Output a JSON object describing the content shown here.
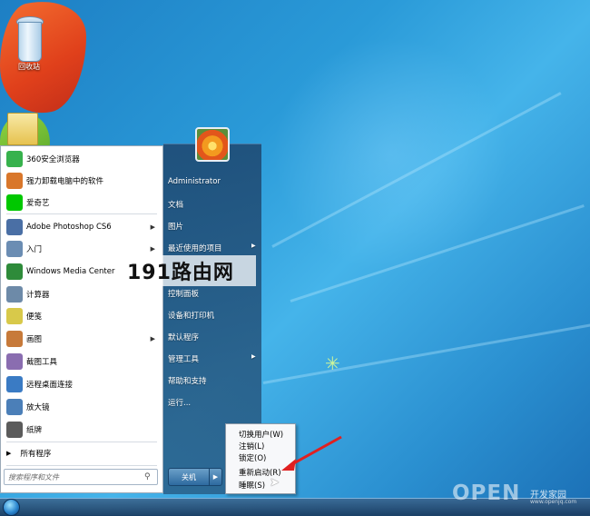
{
  "desktop": {
    "icons": [
      {
        "label": "回收站"
      }
    ]
  },
  "start_menu": {
    "programs": [
      {
        "label": "360安全浏览器",
        "icon": "360-browser-icon",
        "color": "#37b24d",
        "has_submenu": false
      },
      {
        "label": "强力卸载电脑中的软件",
        "icon": "uninstall-icon",
        "color": "#d9772b",
        "has_submenu": false
      },
      {
        "label": "爱奇艺",
        "icon": "iqiyi-icon",
        "color": "#00c800",
        "has_submenu": false
      },
      {
        "label": "Adobe Photoshop CS6",
        "icon": "photoshop-icon",
        "color": "#4a6fa5",
        "has_submenu": true
      },
      {
        "label": "入门",
        "icon": "getting-started-icon",
        "color": "#6b8db3",
        "has_submenu": true
      },
      {
        "label": "Windows Media Center",
        "icon": "media-center-icon",
        "color": "#2e8b3a",
        "has_submenu": false
      },
      {
        "label": "计算器",
        "icon": "calculator-icon",
        "color": "#6d8aa8",
        "has_submenu": false
      },
      {
        "label": "便笺",
        "icon": "sticky-notes-icon",
        "color": "#d8c94a",
        "has_submenu": false
      },
      {
        "label": "画图",
        "icon": "paint-icon",
        "color": "#c77a3a",
        "has_submenu": true
      },
      {
        "label": "截图工具",
        "icon": "snipping-tool-icon",
        "color": "#8a6db0",
        "has_submenu": false
      },
      {
        "label": "远程桌面连接",
        "icon": "remote-desktop-icon",
        "color": "#3a7bc4",
        "has_submenu": false
      },
      {
        "label": "放大镜",
        "icon": "magnifier-icon",
        "color": "#4b7fb8",
        "has_submenu": false
      },
      {
        "label": "纸牌",
        "icon": "solitaire-icon",
        "color": "#5b5b5b",
        "has_submenu": false
      }
    ],
    "all_programs": "所有程序",
    "search_placeholder": "搜索程序和文件",
    "right_items": [
      {
        "label": "Administrator",
        "has_submenu": false
      },
      {
        "label": "文档",
        "has_submenu": false
      },
      {
        "label": "图片",
        "has_submenu": false
      },
      {
        "label": "最近使用的项目",
        "has_submenu": true
      },
      {
        "label": "控制面板",
        "has_submenu": false
      },
      {
        "label": "设备和打印机",
        "has_submenu": false
      },
      {
        "label": "默认程序",
        "has_submenu": false
      },
      {
        "label": "管理工具",
        "has_submenu": true
      },
      {
        "label": "帮助和支持",
        "has_submenu": false
      },
      {
        "label": "运行...",
        "has_submenu": false
      }
    ],
    "shutdown_label": "关机",
    "shutdown_submenu": [
      {
        "label": "切换用户(W)"
      },
      {
        "label": "注销(L)"
      },
      {
        "label": "锁定(O)"
      },
      {
        "label": "重新启动(R)"
      },
      {
        "label": "睡眠(S)"
      }
    ]
  },
  "watermarks": {
    "center": "191路由网",
    "corner_big": "OPEN",
    "corner_cn": "开发家园",
    "corner_url": "www.openjq.com"
  },
  "colors": {
    "desktop_bg": "#2a9ad8",
    "menu_right_bg": "#285a82",
    "arrow_red": "#e02020"
  }
}
